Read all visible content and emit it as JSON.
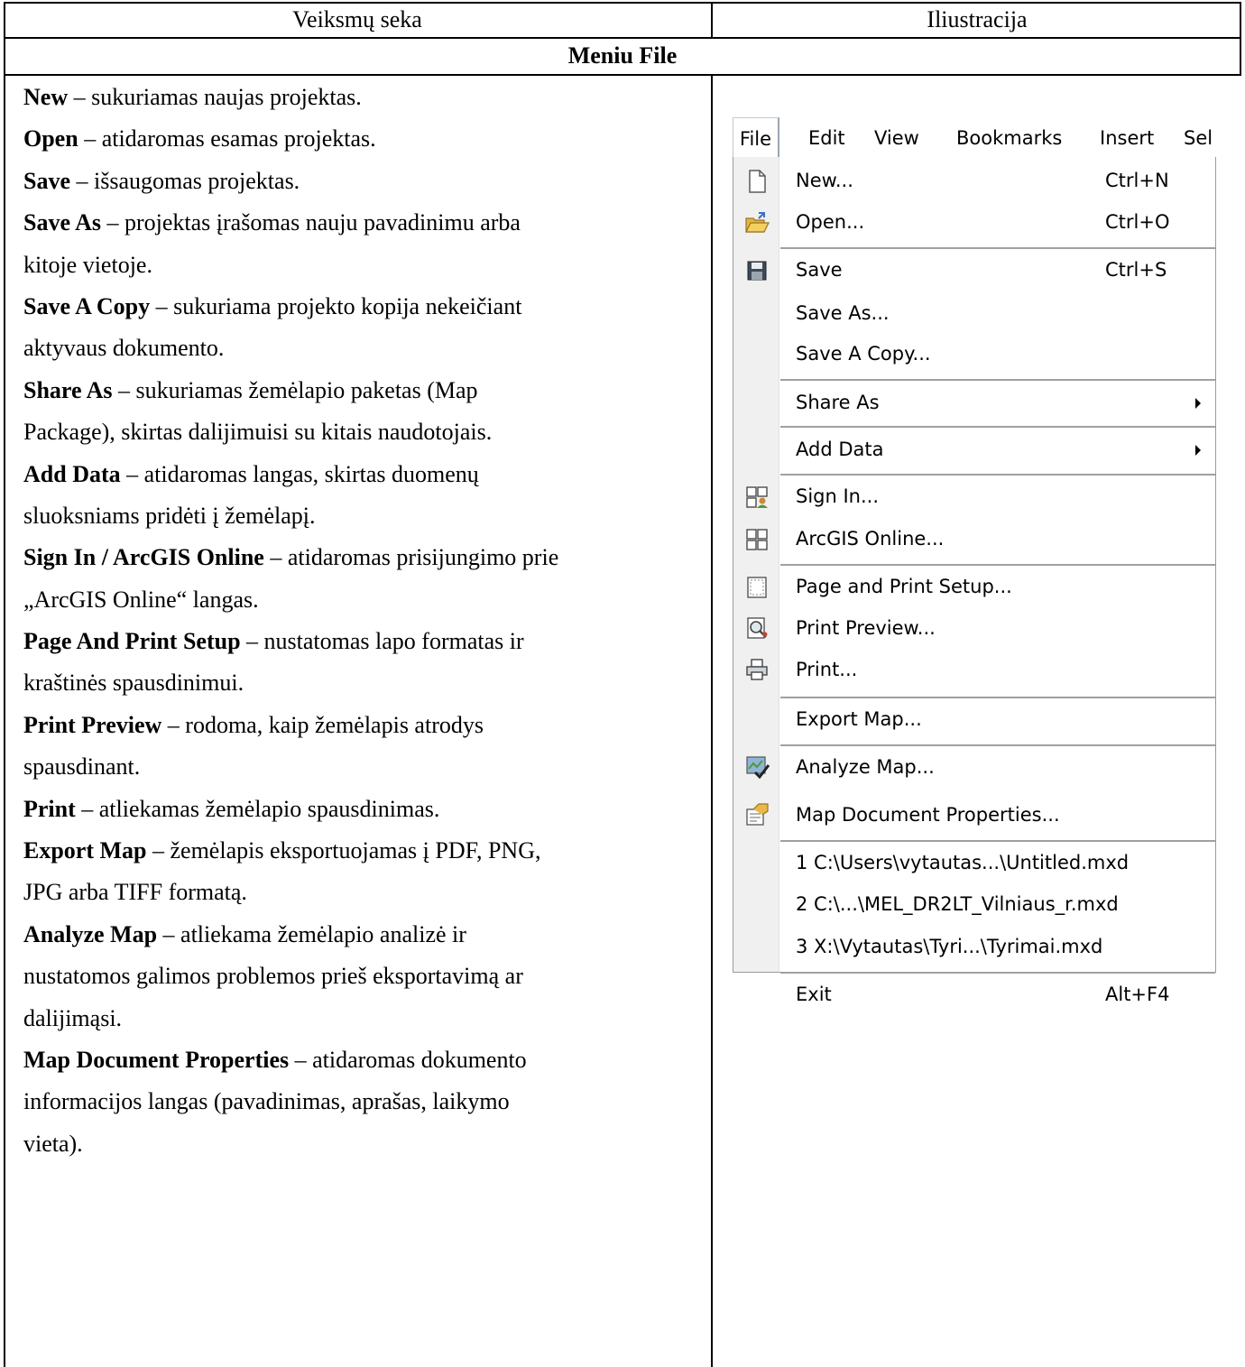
{
  "table": {
    "header_left": "Veiksmų seka",
    "header_right": "Iliustracija",
    "section_title": "Meniu File",
    "text_lines": [
      {
        "b": "New",
        "t": " – sukuriamas naujas projektas."
      },
      {
        "b": "Open",
        "t": " – atidaromas esamas projektas."
      },
      {
        "b": "Save",
        "t": " – išsaugomas projektas."
      },
      {
        "b": "Save As",
        "t": " – projektas įrašomas nauju pavadinimu arba"
      },
      {
        "b": "",
        "t": "kitoje vietoje."
      },
      {
        "b": "Save A Copy",
        "t": " – sukuriama projekto kopija nekeičiant"
      },
      {
        "b": "",
        "t": "aktyvaus dokumento."
      },
      {
        "b": "Share As",
        "t": " – sukuriamas žemėlapio paketas (Map"
      },
      {
        "b": "",
        "t": "Package), skirtas dalijimuisi su kitais naudotojais."
      },
      {
        "b": "Add Data",
        "t": " – atidaromas langas, skirtas duomenų"
      },
      {
        "b": "",
        "t": "sluoksniams pridėti į žemėlapį."
      },
      {
        "b": "Sign In / ArcGIS Online",
        "t": " – atidaromas prisijungimo prie"
      },
      {
        "b": "",
        "t": "„ArcGIS Online“ langas."
      },
      {
        "b": "Page And Print Setup",
        "t": " – nustatomas lapo formatas ir"
      },
      {
        "b": "",
        "t": "kraštinės spausdinimui."
      },
      {
        "b": "Print Preview",
        "t": " – rodoma, kaip žemėlapis atrodys"
      },
      {
        "b": "",
        "t": "spausdinant."
      },
      {
        "b": "Print",
        "t": " – atliekamas žemėlapio spausdinimas."
      },
      {
        "b": "Export Map",
        "t": " – žemėlapis eksportuojamas į PDF, PNG,"
      },
      {
        "b": "",
        "t": "JPG arba TIFF formatą."
      },
      {
        "b": "Analyze Map",
        "t": " – atliekama žemėlapio analizė ir"
      },
      {
        "b": "",
        "t": "nustatomos galimos problemos prieš eksportavimą ar"
      },
      {
        "b": "",
        "t": "dalijimąsi."
      },
      {
        "b": "Map Document Properties",
        "t": " – atidaromas dokumento"
      },
      {
        "b": "",
        "t": "informacijos langas (pavadinimas, aprašas, laikymo"
      },
      {
        "b": "",
        "t": "vieta)."
      }
    ]
  },
  "menubar": {
    "file": "File",
    "edit": "Edit",
    "view": "View",
    "bookmarks": "Bookmarks",
    "insert": "Insert",
    "sel": "Sel"
  },
  "menu_items": {
    "new": {
      "label": "New...",
      "shortcut": "Ctrl+N",
      "icon": "new-document-icon"
    },
    "open": {
      "label": "Open...",
      "shortcut": "Ctrl+O",
      "icon": "open-folder-icon"
    },
    "save": {
      "label": "Save",
      "shortcut": "Ctrl+S",
      "icon": "floppy-disk-icon"
    },
    "save_as": {
      "label": "Save As..."
    },
    "save_copy": {
      "label": "Save A Copy..."
    },
    "share_as": {
      "label": "Share As"
    },
    "add_data": {
      "label": "Add Data"
    },
    "sign_in": {
      "label": "Sign In...",
      "icon": "sign-in-icon"
    },
    "arcgis_online": {
      "label": "ArcGIS Online...",
      "icon": "arcgis-online-icon"
    },
    "page_setup": {
      "label": "Page and Print Setup...",
      "icon": "page-setup-icon"
    },
    "print_preview": {
      "label": "Print Preview...",
      "icon": "print-preview-icon"
    },
    "print": {
      "label": "Print...",
      "icon": "printer-icon"
    },
    "export_map": {
      "label": "Export Map..."
    },
    "analyze_map": {
      "label": "Analyze Map...",
      "icon": "analyze-map-icon"
    },
    "doc_props": {
      "label": "Map Document Properties...",
      "icon": "document-properties-icon"
    },
    "recent_1": {
      "label": "1 C:\\Users\\vytautas...\\Untitled.mxd"
    },
    "recent_2": {
      "label": "2 C:\\...\\MEL_DR2LT_Vilniaus_r.mxd"
    },
    "recent_3": {
      "label": "3 X:\\Vytautas\\Tyri...\\Tyrimai.mxd"
    },
    "exit": {
      "label": "Exit",
      "shortcut": "Alt+F4"
    }
  }
}
